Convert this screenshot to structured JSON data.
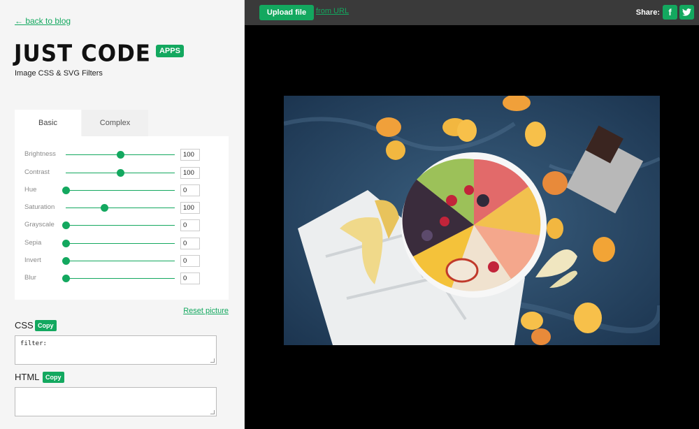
{
  "nav": {
    "back_label": "← back to blog"
  },
  "brand": {
    "name": "JUST CODE",
    "badge": "APPS",
    "subtitle": "Image CSS & SVG Filters",
    "accent": "#13a85f"
  },
  "tabs": [
    {
      "label": "Basic",
      "active": true
    },
    {
      "label": "Complex",
      "active": false
    }
  ],
  "filters": [
    {
      "label": "Brightness",
      "value": "100",
      "level": 0.5
    },
    {
      "label": "Contrast",
      "value": "100",
      "level": 0.5
    },
    {
      "label": "Hue",
      "value": "0",
      "level": 0
    },
    {
      "label": "Saturation",
      "value": "100",
      "level": 0.35
    },
    {
      "label": "Grayscale",
      "value": "0",
      "level": 0
    },
    {
      "label": "Sepia",
      "value": "0",
      "level": 0
    },
    {
      "label": "Invert",
      "value": "0",
      "level": 0
    },
    {
      "label": "Blur",
      "value": "0",
      "level": 0
    }
  ],
  "reset_label": "Reset picture",
  "css_section": {
    "label": "CSS",
    "copy": "Copy",
    "value": "filter:"
  },
  "html_section": {
    "label": "HTML",
    "copy": "Copy",
    "value": ""
  },
  "topbar": {
    "upload": "Upload file",
    "from_url": "from URL",
    "share": "Share:",
    "facebook": "f",
    "twitter": "twitter-icon"
  },
  "image": {
    "subject": "fruit-bowl-photo"
  }
}
